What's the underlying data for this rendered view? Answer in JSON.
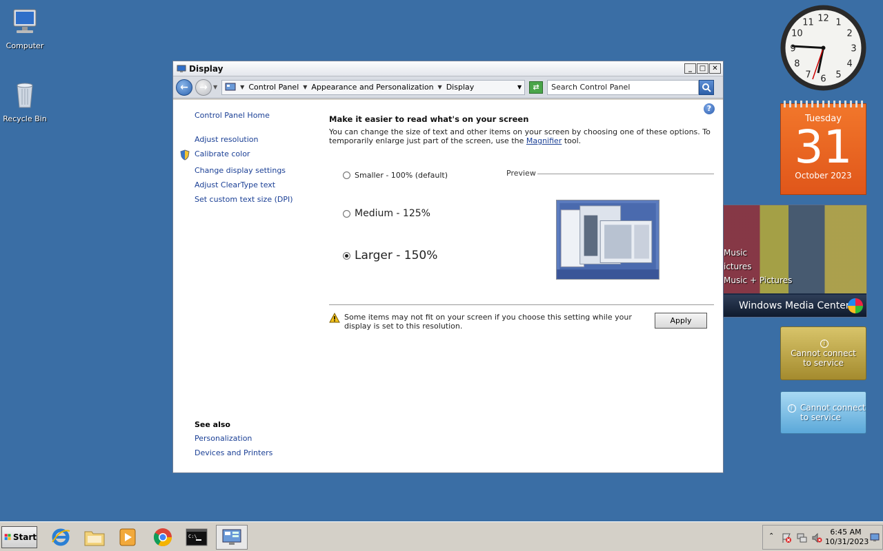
{
  "desktop": {
    "icons": [
      {
        "label": "Computer"
      },
      {
        "label": "Recycle Bin"
      }
    ]
  },
  "window": {
    "title": "Display",
    "controls": {
      "minimize": "_",
      "maximize": "□",
      "close": "✕"
    },
    "breadcrumbs": [
      "Control Panel",
      "Appearance and Personalization",
      "Display"
    ],
    "search_placeholder": "Search Control Panel"
  },
  "left_pane": {
    "home": "Control Panel Home",
    "links": [
      "Adjust resolution",
      "Calibrate color",
      "Change display settings",
      "Adjust ClearType text",
      "Set custom text size (DPI)"
    ],
    "see_also_heading": "See also",
    "see_also": [
      "Personalization",
      "Devices and Printers"
    ]
  },
  "main": {
    "help": "?",
    "heading": "Make it easier to read what's on your screen",
    "desc_before": "You can change the size of text and other items on your screen by choosing one of these options. To temporarily enlarge just part of the screen, use the ",
    "desc_link": "Magnifier",
    "desc_after": " tool.",
    "options": [
      {
        "label": "Smaller - 100% (default)",
        "checked": false
      },
      {
        "label": "Medium - 125%",
        "checked": false
      },
      {
        "label": "Larger - 150%",
        "checked": true
      }
    ],
    "preview_label": "Preview",
    "warning": "Some items may not fit on your screen if you choose this setting while your display is set to this resolution.",
    "apply_label": "Apply"
  },
  "gadgets": {
    "calendar": {
      "day": "Tuesday",
      "date": "31",
      "month": "October 2023"
    },
    "clock_numbers": [
      "12",
      "1",
      "2",
      "3",
      "4",
      "5",
      "6",
      "7",
      "8",
      "9",
      "10",
      "11"
    ],
    "media_center": {
      "items": [
        "Music",
        "ictures",
        "Music + Pictures"
      ],
      "title": "Windows Media Center"
    },
    "weather1": {
      "line1": "Cannot connect",
      "line2": "to service"
    },
    "weather2": {
      "line1": "Cannot connect",
      "line2": "to service"
    }
  },
  "taskbar": {
    "start_label": "Start",
    "time": "6:45 AM",
    "date": "10/31/2023"
  },
  "colors": {
    "desktop": "#3a6ea5",
    "link": "#1a3f95",
    "calendar": "#e8622a"
  }
}
